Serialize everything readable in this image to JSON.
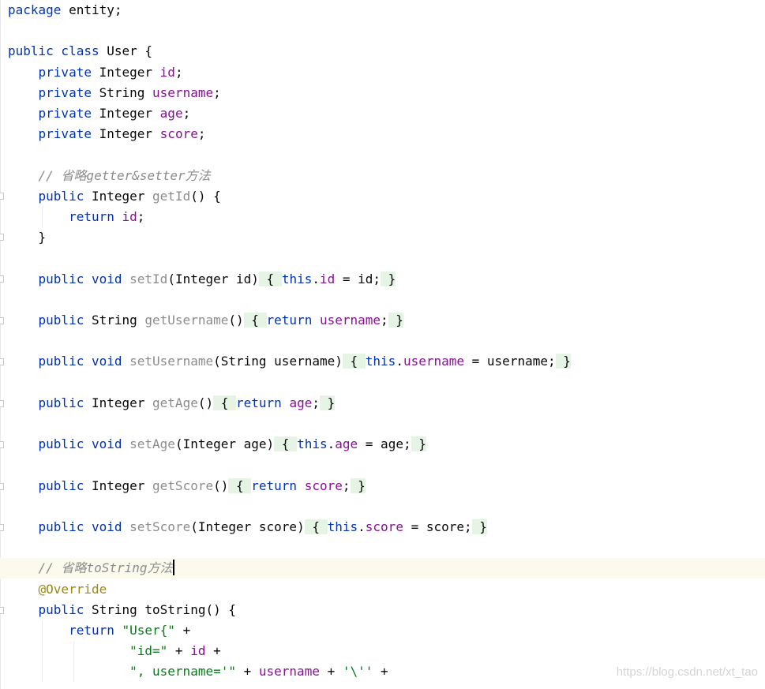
{
  "editor": {
    "language": "java",
    "colors": {
      "keyword": "#0033b3",
      "field": "#871094",
      "method_call_grey": "#8c8c8c",
      "comment": "#8c8c8c",
      "string": "#067d17",
      "annotation": "#9e880d",
      "folded_brace_bg": "#e6f4e6",
      "current_line_bg": "#fcfaed"
    },
    "lines": [
      {
        "tokens": [
          [
            "kw",
            "package"
          ],
          [
            "p",
            " entity;"
          ]
        ]
      },
      {
        "tokens": []
      },
      {
        "tokens": [
          [
            "kw",
            "public class"
          ],
          [
            "p",
            " User {"
          ]
        ]
      },
      {
        "tokens": [
          [
            "p",
            "    "
          ],
          [
            "kw",
            "private"
          ],
          [
            "p",
            " Integer "
          ],
          [
            "fld",
            "id"
          ],
          [
            "p",
            ";"
          ]
        ]
      },
      {
        "tokens": [
          [
            "p",
            "    "
          ],
          [
            "kw",
            "private"
          ],
          [
            "p",
            " String "
          ],
          [
            "fld",
            "username"
          ],
          [
            "p",
            ";"
          ]
        ]
      },
      {
        "tokens": [
          [
            "p",
            "    "
          ],
          [
            "kw",
            "private"
          ],
          [
            "p",
            " Integer "
          ],
          [
            "fld",
            "age"
          ],
          [
            "p",
            ";"
          ]
        ]
      },
      {
        "tokens": [
          [
            "p",
            "    "
          ],
          [
            "kw",
            "private"
          ],
          [
            "p",
            " Integer "
          ],
          [
            "fld",
            "score"
          ],
          [
            "p",
            ";"
          ]
        ]
      },
      {
        "tokens": []
      },
      {
        "tokens": [
          [
            "p",
            "    "
          ],
          [
            "cm",
            "// 省略getter&setter方法"
          ]
        ]
      },
      {
        "tokens": [
          [
            "p",
            "    "
          ],
          [
            "kw",
            "public"
          ],
          [
            "p",
            " Integer "
          ],
          [
            "mc",
            "getId"
          ],
          [
            "p",
            "() {"
          ]
        ]
      },
      {
        "tokens": [
          [
            "p",
            "        "
          ],
          [
            "kw",
            "return"
          ],
          [
            "p",
            " "
          ],
          [
            "fld",
            "id"
          ],
          [
            "p",
            ";"
          ]
        ]
      },
      {
        "tokens": [
          [
            "p",
            "    }"
          ]
        ]
      },
      {
        "tokens": []
      },
      {
        "tokens": [
          [
            "p",
            "    "
          ],
          [
            "kw",
            "public void"
          ],
          [
            "p",
            " "
          ],
          [
            "mc",
            "setId"
          ],
          [
            "p",
            "(Integer id)"
          ],
          [
            "fb",
            " { "
          ],
          [
            "kw",
            "this"
          ],
          [
            "p",
            "."
          ],
          [
            "fld",
            "id"
          ],
          [
            "p",
            " = id;"
          ],
          [
            "fb",
            " }"
          ]
        ]
      },
      {
        "tokens": []
      },
      {
        "tokens": [
          [
            "p",
            "    "
          ],
          [
            "kw",
            "public"
          ],
          [
            "p",
            " String "
          ],
          [
            "mc",
            "getUsername"
          ],
          [
            "p",
            "()"
          ],
          [
            "fb",
            " { "
          ],
          [
            "kw",
            "return"
          ],
          [
            "p",
            " "
          ],
          [
            "fld",
            "username"
          ],
          [
            "p",
            ";"
          ],
          [
            "fb",
            " }"
          ]
        ]
      },
      {
        "tokens": []
      },
      {
        "tokens": [
          [
            "p",
            "    "
          ],
          [
            "kw",
            "public void"
          ],
          [
            "p",
            " "
          ],
          [
            "mc",
            "setUsername"
          ],
          [
            "p",
            "(String username)"
          ],
          [
            "fb",
            " { "
          ],
          [
            "kw",
            "this"
          ],
          [
            "p",
            "."
          ],
          [
            "fld",
            "username"
          ],
          [
            "p",
            " = username;"
          ],
          [
            "fb",
            " }"
          ]
        ]
      },
      {
        "tokens": []
      },
      {
        "tokens": [
          [
            "p",
            "    "
          ],
          [
            "kw",
            "public"
          ],
          [
            "p",
            " Integer "
          ],
          [
            "mc",
            "getAge"
          ],
          [
            "p",
            "()"
          ],
          [
            "fb",
            " { "
          ],
          [
            "kw",
            "return"
          ],
          [
            "p",
            " "
          ],
          [
            "fld",
            "age"
          ],
          [
            "p",
            ";"
          ],
          [
            "fb",
            " }"
          ]
        ]
      },
      {
        "tokens": []
      },
      {
        "tokens": [
          [
            "p",
            "    "
          ],
          [
            "kw",
            "public void"
          ],
          [
            "p",
            " "
          ],
          [
            "mc",
            "setAge"
          ],
          [
            "p",
            "(Integer age)"
          ],
          [
            "fb",
            " { "
          ],
          [
            "kw",
            "this"
          ],
          [
            "p",
            "."
          ],
          [
            "fld",
            "age"
          ],
          [
            "p",
            " = age;"
          ],
          [
            "fb",
            " }"
          ]
        ]
      },
      {
        "tokens": []
      },
      {
        "tokens": [
          [
            "p",
            "    "
          ],
          [
            "kw",
            "public"
          ],
          [
            "p",
            " Integer "
          ],
          [
            "mc",
            "getScore"
          ],
          [
            "p",
            "()"
          ],
          [
            "fb",
            " { "
          ],
          [
            "kw",
            "return"
          ],
          [
            "p",
            " "
          ],
          [
            "fld",
            "score"
          ],
          [
            "p",
            ";"
          ],
          [
            "fb",
            " }"
          ]
        ]
      },
      {
        "tokens": []
      },
      {
        "tokens": [
          [
            "p",
            "    "
          ],
          [
            "kw",
            "public void"
          ],
          [
            "p",
            " "
          ],
          [
            "mc",
            "setScore"
          ],
          [
            "p",
            "(Integer score)"
          ],
          [
            "fb",
            " { "
          ],
          [
            "kw",
            "this"
          ],
          [
            "p",
            "."
          ],
          [
            "fld",
            "score"
          ],
          [
            "p",
            " = score;"
          ],
          [
            "fb",
            " }"
          ]
        ]
      },
      {
        "tokens": []
      },
      {
        "tokens": [
          [
            "p",
            "    "
          ],
          [
            "cm",
            "// 省略toString方法"
          ]
        ],
        "current": true
      },
      {
        "tokens": [
          [
            "p",
            "    "
          ],
          [
            "ann",
            "@Override"
          ]
        ]
      },
      {
        "tokens": [
          [
            "p",
            "    "
          ],
          [
            "kw",
            "public"
          ],
          [
            "p",
            " String toString() {"
          ]
        ]
      },
      {
        "tokens": [
          [
            "p",
            "        "
          ],
          [
            "kw",
            "return"
          ],
          [
            "p",
            " "
          ],
          [
            "str",
            "\"User{\""
          ],
          [
            "p",
            " +"
          ]
        ]
      },
      {
        "tokens": [
          [
            "p",
            "                "
          ],
          [
            "str",
            "\"id=\""
          ],
          [
            "p",
            " + "
          ],
          [
            "fld",
            "id"
          ],
          [
            "p",
            " +"
          ]
        ]
      },
      {
        "tokens": [
          [
            "p",
            "                "
          ],
          [
            "str",
            "\", username='\""
          ],
          [
            "p",
            " + "
          ],
          [
            "fld",
            "username"
          ],
          [
            "p",
            " + "
          ],
          [
            "str",
            "'\\''"
          ],
          [
            "p",
            " +"
          ]
        ]
      }
    ]
  },
  "watermark": "https://blog.csdn.net/xt_tao"
}
